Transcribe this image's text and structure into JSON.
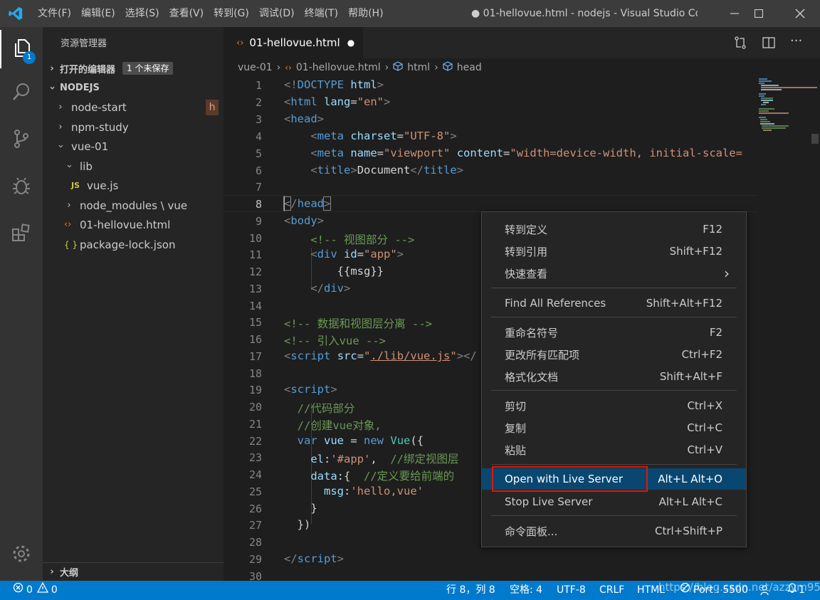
{
  "menu": [
    "文件(F)",
    "编辑(E)",
    "选择(S)",
    "查看(V)",
    "转到(G)",
    "调试(D)",
    "终端(T)",
    "帮助(H)"
  ],
  "window_title": "● 01-hellovue.html - nodejs - Visual Studio Co...",
  "activity": {
    "explorer_badge": "1"
  },
  "sidebar": {
    "title": "资源管理器",
    "open_editors": {
      "label": "打开的编辑器",
      "badge": "1 个未保存"
    },
    "workspace": "NODEJS",
    "items": [
      {
        "label": "node-start"
      },
      {
        "label": "npm-study"
      },
      {
        "label": "vue-01"
      },
      {
        "label": "lib"
      },
      {
        "label": "vue.js",
        "icon_text": "JS"
      },
      {
        "label": "node_modules \\ vue"
      },
      {
        "label": "01-hellovue.html"
      },
      {
        "label": "package-lock.json",
        "icon_text": "{ }"
      }
    ],
    "h_badge": "h",
    "outline": "大纲"
  },
  "tab": {
    "label": "01-hellovue.html",
    "dirty": "●"
  },
  "breadcrumb": [
    "vue-01",
    "01-hellovue.html",
    "html",
    "head"
  ],
  "code_lines": [
    "1",
    "2",
    "3",
    "4",
    "5",
    "6",
    "7",
    "8",
    "9",
    "10",
    "11",
    "12",
    "13",
    "14",
    "15",
    "16",
    "17",
    "18",
    "19",
    "20",
    "21",
    "22",
    "23",
    "24",
    "25",
    "26",
    "27",
    "28",
    "29",
    "30"
  ],
  "context_menu": {
    "groups": [
      [
        {
          "label": "转到定义",
          "key": "F12"
        },
        {
          "label": "转到引用",
          "key": "Shift+F12"
        },
        {
          "label": "快速查看",
          "key": "›"
        }
      ],
      [
        {
          "label": "Find All References",
          "key": "Shift+Alt+F12"
        }
      ],
      [
        {
          "label": "重命名符号",
          "key": "F2"
        },
        {
          "label": "更改所有匹配项",
          "key": "Ctrl+F2"
        },
        {
          "label": "格式化文档",
          "key": "Shift+Alt+F"
        }
      ],
      [
        {
          "label": "剪切",
          "key": "Ctrl+X"
        },
        {
          "label": "复制",
          "key": "Ctrl+C"
        },
        {
          "label": "粘贴",
          "key": "Ctrl+V"
        }
      ],
      [
        {
          "label": "Open with Live Server",
          "key": "Alt+L Alt+O"
        },
        {
          "label": "Stop Live Server",
          "key": "Alt+L Alt+C"
        }
      ],
      [
        {
          "label": "命令面板...",
          "key": "Ctrl+Shift+P"
        }
      ]
    ]
  },
  "status": {
    "errors": "0",
    "warnings": "0",
    "position": "行 8，列 8",
    "spaces": "空格: 4",
    "encoding": "UTF-8",
    "eol": "CRLF",
    "language": "HTML",
    "port": "Port : 5500",
    "notif": "1",
    "watermark": "https://blog.csdn.net/azzym95"
  },
  "colors": {
    "accent": "#007acc",
    "highlight": "#094771",
    "redbox": "#e51400"
  }
}
